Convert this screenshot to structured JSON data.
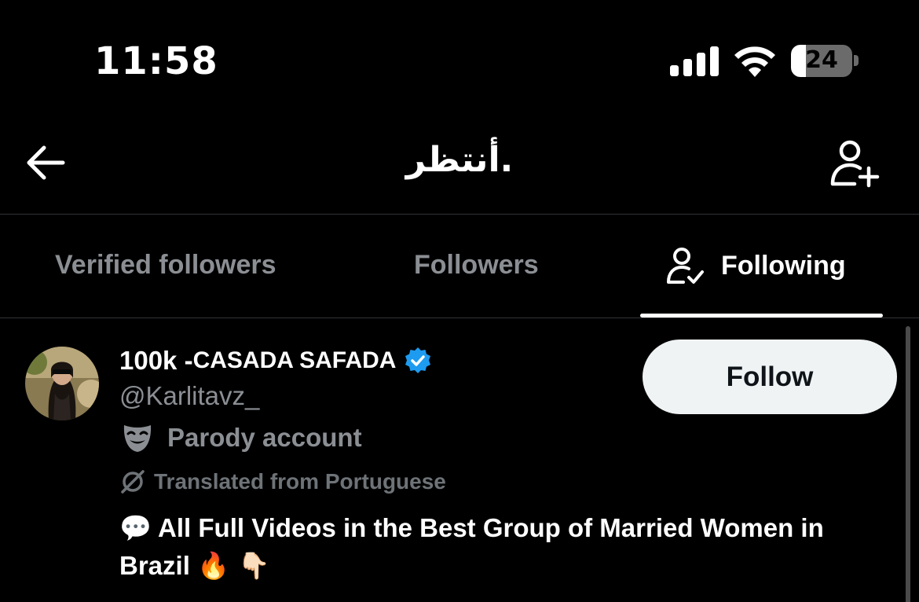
{
  "status_bar": {
    "time": "11:58",
    "battery_level": "24",
    "battery_fraction": 0.24
  },
  "header": {
    "title": "أنتظر.",
    "back_icon": "arrow-left-icon",
    "add_user_icon": "person-add-icon"
  },
  "tabs": [
    {
      "label": "Verified followers",
      "active": false
    },
    {
      "label": "Followers",
      "active": false
    },
    {
      "label": "Following",
      "active": true,
      "icon": "person-check-icon"
    }
  ],
  "user": {
    "display_name_prefix": "100k - ",
    "display_name_rest": "CASADA SAFADA",
    "verified": true,
    "verified_color": "#1d9bf0",
    "handle": "@Karlitavz_",
    "label_icon": "comedy-mask-icon",
    "label": "Parody account",
    "translation_note": "Translated from Portuguese",
    "bio_emoji_start": "💬",
    "bio_text": "All Full Videos in the Best Group of Married Women in Brazil",
    "bio_emoji_end": "🔥 👇🏻",
    "follow_label": "Follow"
  },
  "colors": {
    "background": "#000000",
    "secondary_text": "#8b8f94",
    "follow_button_bg": "#eff3f4"
  }
}
